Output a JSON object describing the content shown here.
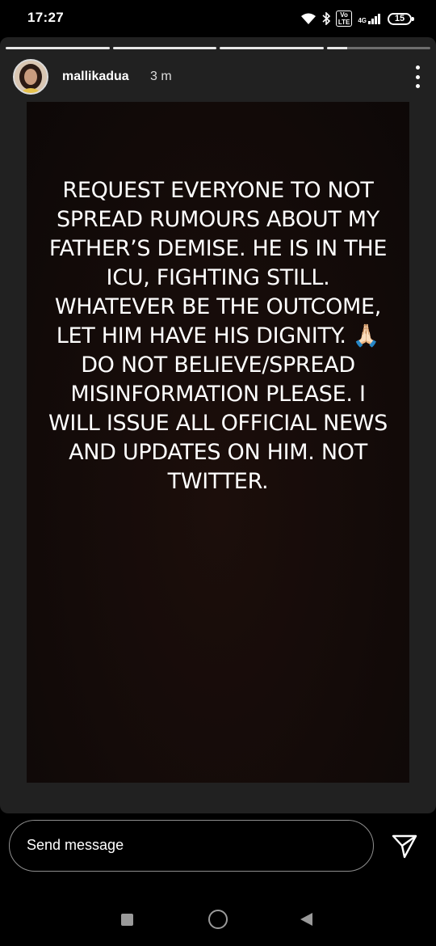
{
  "status_bar": {
    "time": "17:27",
    "volte_label": "Vo\nLTE",
    "network_label": "4G",
    "battery": "15"
  },
  "story": {
    "progress": [
      1,
      1,
      1,
      0.2
    ],
    "username": "mallikadua",
    "timestamp": "3 m",
    "text": "REQUEST EVERYONE TO NOT SPREAD RUMOURS ABOUT MY FATHER’S DEMISE. HE IS IN THE ICU, FIGHTING STILL. WHATEVER BE THE OUTCOME, LET HIM HAVE HIS DIGNITY. 🙏🏻 DO NOT BELIEVE/SPREAD MISINFORMATION PLEASE. I WILL ISSUE ALL OFFICIAL NEWS AND UPDATES ON HIM. NOT TWITTER."
  },
  "message_bar": {
    "placeholder": "Send message"
  },
  "icons": {
    "send": "paper-plane-icon",
    "more": "more-vertical-icon"
  },
  "colors": {
    "background": "#000000",
    "card": "#212121",
    "nav": "#9a9a9a"
  }
}
